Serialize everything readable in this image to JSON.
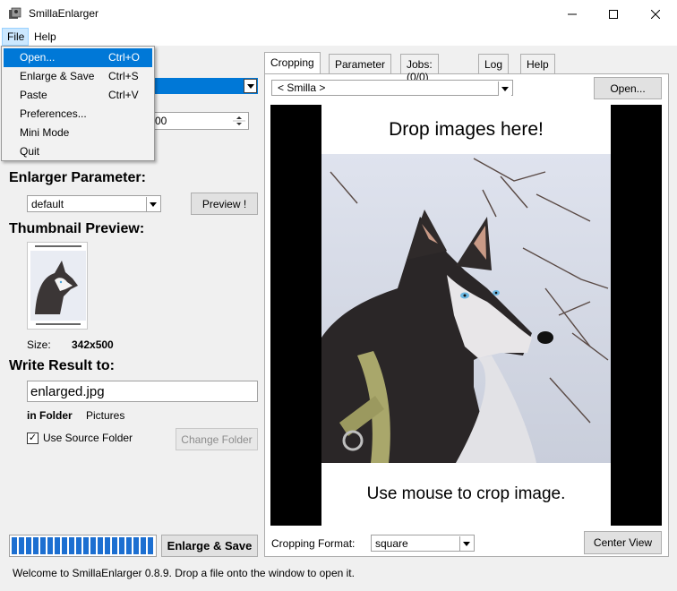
{
  "window": {
    "title": "SmillaEnlarger"
  },
  "menubar": {
    "file": "File",
    "help": "Help"
  },
  "file_menu": {
    "items": [
      {
        "label": "Open...",
        "shortcut": "Ctrl+O"
      },
      {
        "label": "Enlarge & Save",
        "shortcut": "Ctrl+S"
      },
      {
        "label": "Paste",
        "shortcut": "Ctrl+V"
      },
      {
        "label": "Preferences...",
        "shortcut": ""
      },
      {
        "label": "Mini Mode",
        "shortcut": ""
      },
      {
        "label": "Quit",
        "shortcut": ""
      }
    ]
  },
  "left": {
    "spin_value": "00",
    "enlarger_parameter_title": "Enlarger Parameter:",
    "parameter_selected": "default",
    "preview_button": "Preview !",
    "thumbnail_title": "Thumbnail Preview:",
    "size_label": "Size:",
    "size_value": "342x500",
    "write_title": "Write Result to:",
    "output_filename": "enlarged.jpg",
    "in_folder_label": "in Folder",
    "folder_name": "Pictures",
    "use_source_folder_label": "Use Source Folder",
    "use_source_folder_checked": "✓",
    "change_folder_button": "Change Folder",
    "enlarge_save_button": "Enlarge & Save"
  },
  "progress": {
    "fraction": 1.0,
    "segments": 20
  },
  "tabs": [
    "Cropping",
    "Parameter",
    "Jobs: (0/0)",
    "Log",
    "Help"
  ],
  "cropping": {
    "preset": "< Smilla >",
    "open_button": "Open...",
    "drop_text": "Drop images here!",
    "crop_hint": "Use mouse to crop image.",
    "format_label": "Cropping Format:",
    "format_value": "square",
    "center_view_button": "Center View"
  },
  "status": {
    "text": "Welcome to SmillaEnlarger 0.8.9.  Drop a file onto the window to open it."
  },
  "colors": {
    "accent": "#0078d7",
    "progress": "#1c6fd1",
    "menu_highlight": "#cce8ff"
  }
}
